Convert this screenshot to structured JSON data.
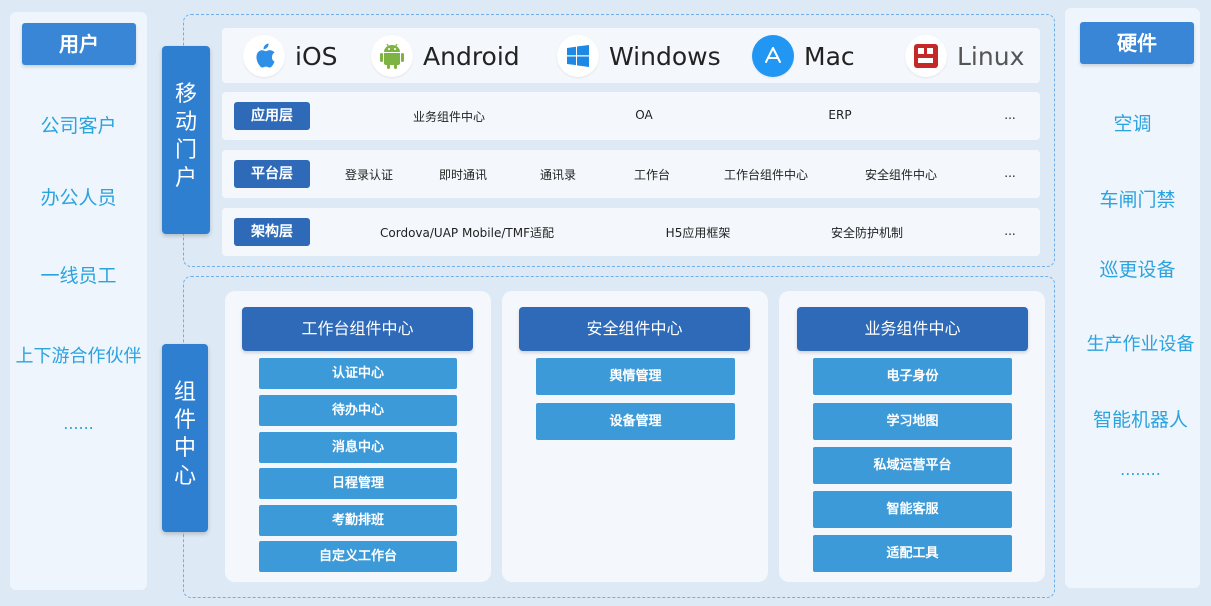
{
  "users": {
    "title": "用户",
    "items": [
      "公司客户",
      "办公人员",
      "一线员工",
      "上下游合作伙伴",
      "......"
    ]
  },
  "hardware": {
    "title": "硬件",
    "items": [
      "空调",
      "车闸门禁",
      "巡更设备",
      "生产作业设备",
      "智能机器人",
      "........"
    ]
  },
  "mobile_portal": {
    "label": [
      "移",
      "动",
      "门",
      "户"
    ],
    "platforms": [
      {
        "name": "iOS",
        "icon": "apple-icon"
      },
      {
        "name": "Android",
        "icon": "android-icon"
      },
      {
        "name": "Windows",
        "icon": "windows-icon"
      },
      {
        "name": "Mac",
        "icon": "app-store-icon"
      },
      {
        "name": "Linux",
        "icon": "linux-icon"
      }
    ],
    "layers": [
      {
        "tag": "应用层",
        "items": [
          "业务组件中心",
          "OA",
          "ERP",
          "..."
        ]
      },
      {
        "tag": "平台层",
        "items": [
          "登录认证",
          "即时通讯",
          "通讯录",
          "工作台",
          "工作台组件中心",
          "安全组件中心",
          "..."
        ]
      },
      {
        "tag": "架构层",
        "items": [
          "Cordova/UAP Mobile/TMF适配",
          "H5应用框架",
          "安全防护机制",
          "..."
        ]
      }
    ]
  },
  "component_center": {
    "label": [
      "组",
      "件",
      "中",
      "心"
    ],
    "columns": [
      {
        "title": "工作台组件中心",
        "items": [
          "认证中心",
          "待办中心",
          "消息中心",
          "日程管理",
          "考勤排班",
          "自定义工作台"
        ]
      },
      {
        "title": "安全组件中心",
        "items": [
          "舆情管理",
          "设备管理"
        ]
      },
      {
        "title": "业务组件中心",
        "items": [
          "电子身份",
          "学习地图",
          "私域运营平台",
          "智能客服",
          "适配工具"
        ]
      }
    ]
  },
  "colors": {
    "title_blue": "#3a86d6",
    "dark_blue": "#2e6ab7",
    "item_blue": "#3d9ad8",
    "text_cyan": "#2ba3df"
  }
}
